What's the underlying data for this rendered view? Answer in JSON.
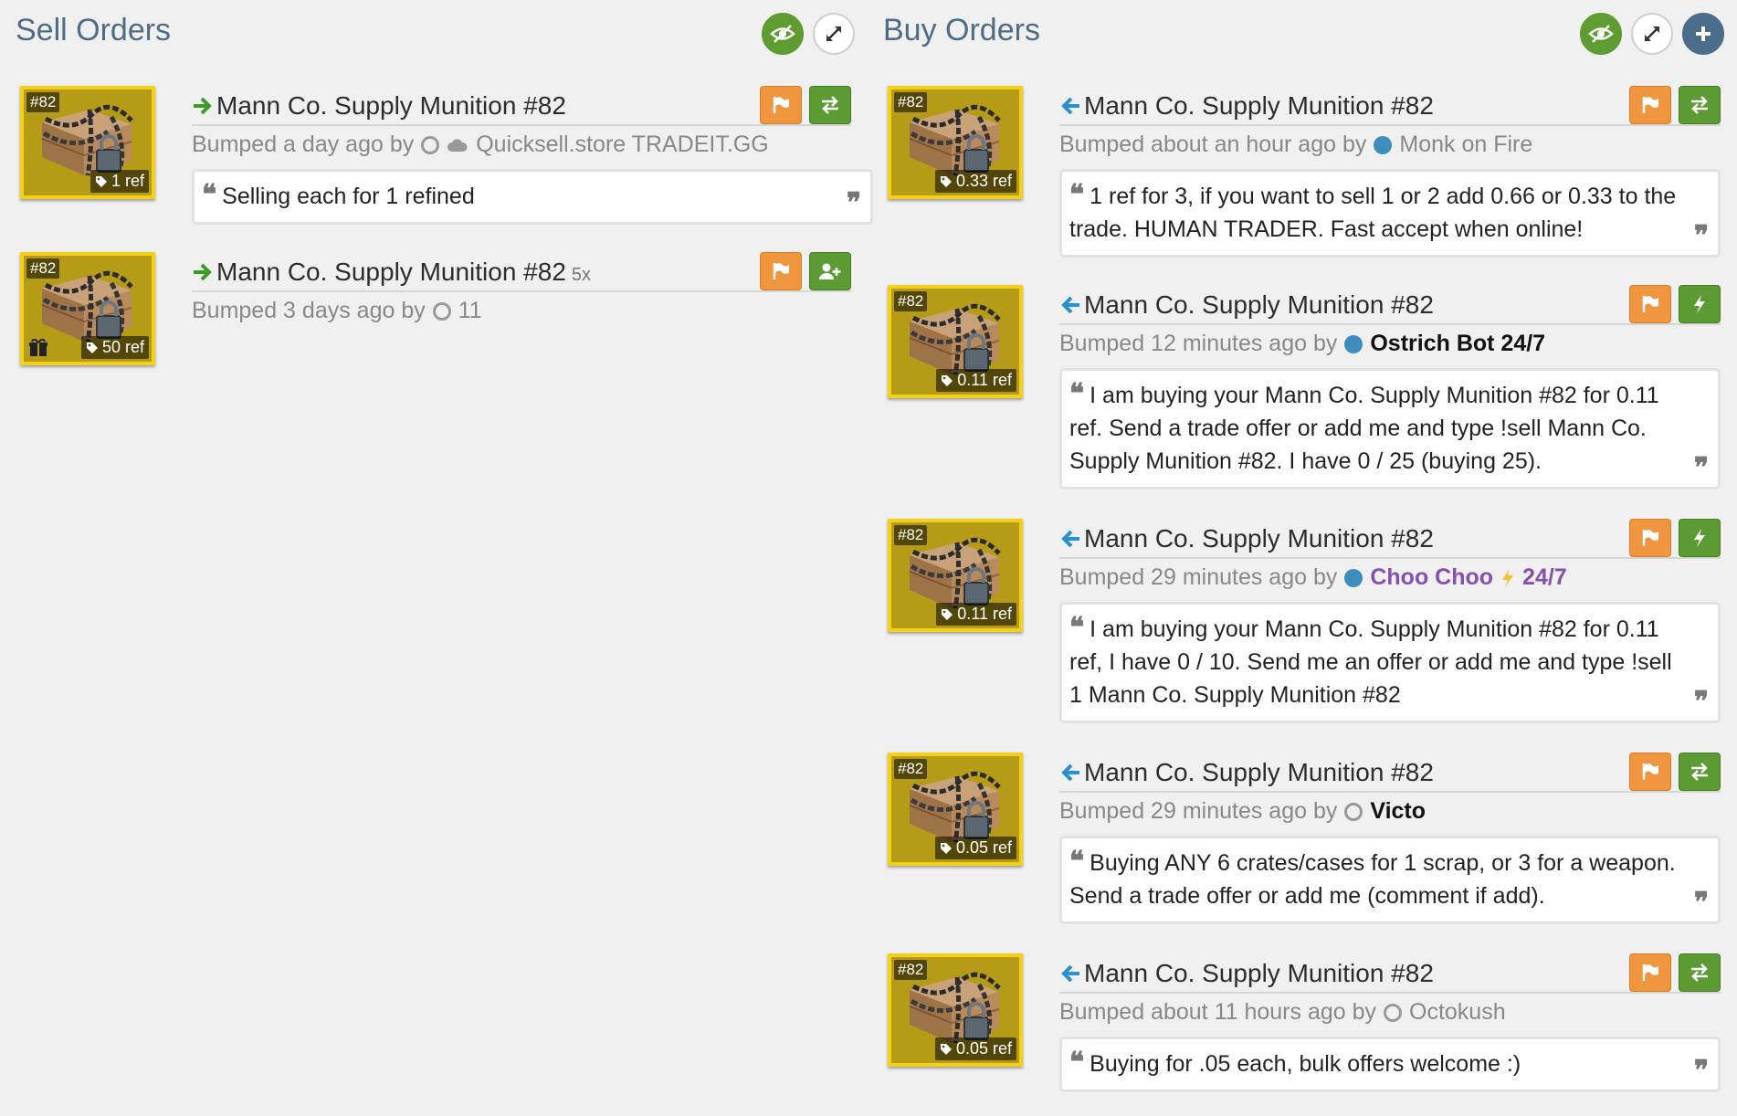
{
  "sell": {
    "title": "Sell Orders",
    "listings": [
      {
        "item_name": "Mann Co. Supply Munition #82",
        "qty": "",
        "num_tag": "#82",
        "price": "1 ref",
        "bumped_prefix": "Bumped a day ago by",
        "user": "Quicksell.store TRADEIT.GG",
        "message": "Selling each for 1 refined",
        "action": "trade"
      },
      {
        "item_name": "Mann Co. Supply Munition #82",
        "qty": "5x",
        "num_tag": "#82",
        "price": "50 ref",
        "bumped_prefix": "Bumped 3 days ago by",
        "user": "11",
        "message": "",
        "action": "add-friend"
      }
    ]
  },
  "buy": {
    "title": "Buy Orders",
    "listings": [
      {
        "item_name": "Mann Co. Supply Munition #82",
        "num_tag": "#82",
        "price": "0.33 ref",
        "bumped_prefix": "Bumped about an hour ago by",
        "user": "Monk on Fire",
        "message": "1 ref for 3, if you want to sell 1 or 2 add 0.66 or 0.33 to the trade. HUMAN TRADER. Fast accept when online!",
        "action": "trade"
      },
      {
        "item_name": "Mann Co. Supply Munition #82",
        "num_tag": "#82",
        "price": "0.11 ref",
        "bumped_prefix": "Bumped 12 minutes ago by",
        "user": "Ostrich Bot 24/7",
        "message": "I am buying your Mann Co. Supply Munition #82 for 0.11 ref. Send a trade offer or add me and type !sell Mann Co. Supply Munition #82. I have 0 / 25 (buying 25).",
        "action": "instant"
      },
      {
        "item_name": "Mann Co. Supply Munition #82",
        "num_tag": "#82",
        "price": "0.11 ref",
        "bumped_prefix": "Bumped 29 minutes ago by",
        "user": "Choo Choo",
        "user_suffix": "24/7",
        "message": "I am buying your Mann Co. Supply Munition #82 for 0.11 ref, I have 0 / 10. Send me an offer or add me and type !sell 1 Mann Co. Supply Munition #82",
        "action": "instant"
      },
      {
        "item_name": "Mann Co. Supply Munition #82",
        "num_tag": "#82",
        "price": "0.05 ref",
        "bumped_prefix": "Bumped 29 minutes ago by",
        "user": "Victo",
        "message": "Buying ANY 6 crates/cases for 1 scrap, or 3 for a weapon. Send a trade offer or add me (comment if add).",
        "action": "trade"
      },
      {
        "item_name": "Mann Co. Supply Munition #82",
        "num_tag": "#82",
        "price": "0.05 ref",
        "bumped_prefix": "Bumped about 11 hours ago by",
        "user": "Octokush",
        "message": "Buying for .05 each, bulk offers welcome :)",
        "action": "trade"
      }
    ]
  },
  "quote_open": "❝",
  "quote_close": "❞",
  "colors": {
    "sell_arrow": "#3b9a2a",
    "buy_arrow": "#2b8fd1",
    "report": "#f0963e",
    "action": "#5c9a34",
    "thumb_border": "#f4d019"
  },
  "icons": [
    "eye-slash-icon",
    "expand-icon",
    "plus-icon",
    "arrow-right-icon",
    "arrow-left-icon",
    "flag-icon",
    "exchange-icon",
    "user-plus-icon",
    "bolt-icon",
    "tag-icon",
    "gift-icon",
    "quote-left-icon",
    "quote-right-icon"
  ]
}
